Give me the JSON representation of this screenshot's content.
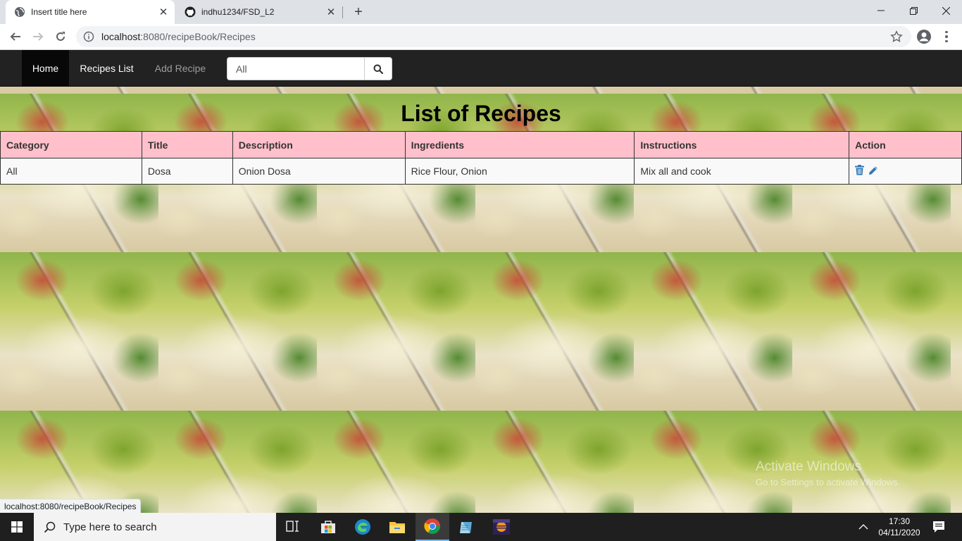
{
  "browser": {
    "tabs": [
      {
        "title": "Insert title here",
        "icon": "globe-icon",
        "active": true
      },
      {
        "title": "indhu1234/FSD_L2",
        "icon": "github-icon",
        "active": false
      }
    ],
    "address": {
      "host": "localhost",
      "path": ":8080/recipeBook/Recipes"
    },
    "status_url": "localhost:8080/recipeBook/Recipes"
  },
  "navbar": {
    "items": [
      {
        "label": "Home",
        "active": true
      },
      {
        "label": "Recipes List"
      },
      {
        "label": "Add Recipe"
      }
    ],
    "search": {
      "value": "All"
    }
  },
  "main": {
    "title": "List of Recipes",
    "table": {
      "headers": [
        "Category",
        "Title",
        "Description",
        "Ingredients",
        "Instructions",
        "Action"
      ],
      "rows": [
        {
          "category": "All",
          "title": "Dosa",
          "description": "Onion Dosa",
          "ingredients": "Rice Flour, Onion",
          "instructions": "Mix all and cook",
          "actions": [
            "trash-icon",
            "pencil-icon"
          ]
        }
      ]
    }
  },
  "watermark": {
    "line1": "Activate Windows",
    "line2": "Go to Settings to activate Windows."
  },
  "taskbar": {
    "search_placeholder": "Type here to search",
    "time": "17:30",
    "date": "04/11/2020"
  },
  "colors": {
    "navbar": "#222222",
    "table_header": "#ffc0cb",
    "accent": "#337ab7"
  }
}
